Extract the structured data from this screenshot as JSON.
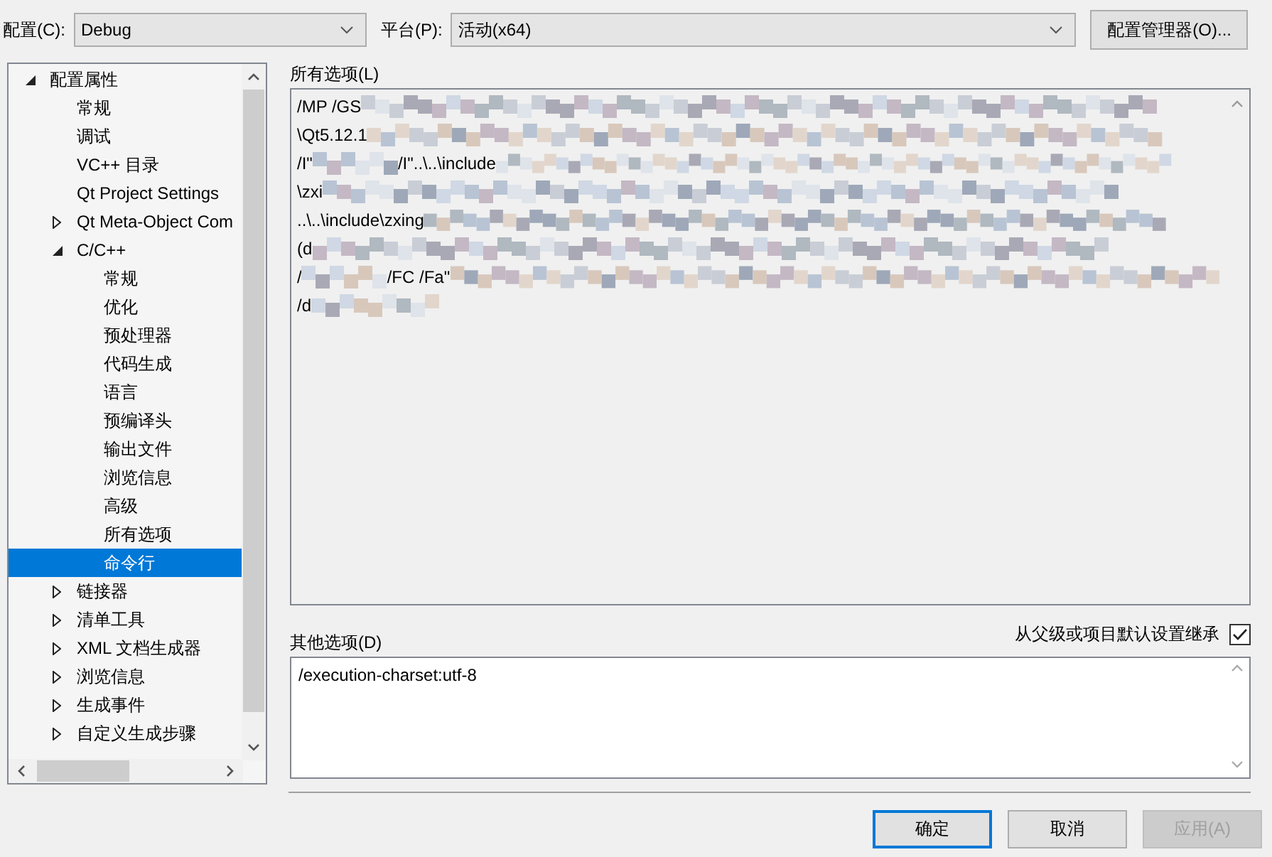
{
  "top_bar": {
    "config_label": "配置(C):",
    "config_value": "Debug",
    "platform_label": "平台(P):",
    "platform_value": "活动(x64)",
    "manager_button": "配置管理器(O)..."
  },
  "tree": [
    {
      "label": "配置属性",
      "expanded": true,
      "selected": false,
      "children": [
        {
          "label": "常规",
          "selected": false
        },
        {
          "label": "调试",
          "selected": false
        },
        {
          "label": "VC++ 目录",
          "selected": false
        },
        {
          "label": "Qt Project Settings",
          "selected": false
        },
        {
          "label": "Qt Meta-Object Com",
          "expanded": false,
          "selected": false
        },
        {
          "label": "C/C++",
          "expanded": true,
          "selected": false,
          "children": [
            {
              "label": "常规",
              "selected": false
            },
            {
              "label": "优化",
              "selected": false
            },
            {
              "label": "预处理器",
              "selected": false
            },
            {
              "label": "代码生成",
              "selected": false
            },
            {
              "label": "语言",
              "selected": false
            },
            {
              "label": "预编译头",
              "selected": false
            },
            {
              "label": "输出文件",
              "selected": false
            },
            {
              "label": "浏览信息",
              "selected": false
            },
            {
              "label": "高级",
              "selected": false
            },
            {
              "label": "所有选项",
              "selected": false
            },
            {
              "label": "命令行",
              "selected": true
            }
          ]
        },
        {
          "label": "链接器",
          "expanded": false,
          "selected": false
        },
        {
          "label": "清单工具",
          "expanded": false,
          "selected": false
        },
        {
          "label": "XML 文档生成器",
          "expanded": false,
          "selected": false
        },
        {
          "label": "浏览信息",
          "expanded": false,
          "selected": false
        },
        {
          "label": "生成事件",
          "expanded": false,
          "selected": false
        },
        {
          "label": "自定义生成步骤",
          "expanded": false,
          "selected": false
        }
      ]
    }
  ],
  "all_options": {
    "label": "所有选项(L)",
    "lines": [
      [
        "/MP /GS"
      ],
      [
        "\\Qt5.12.1"
      ],
      [
        "/I\"",
        "/I\"..\\..\\include"
      ],
      [
        "\\zxi"
      ],
      [
        "..\\..\\include\\zxing"
      ],
      [
        "(d"
      ],
      [
        "/",
        "/FC /Fa\""
      ],
      [
        "/d"
      ]
    ]
  },
  "other_options": {
    "label": "其他选项(D)",
    "inherit_label": "从父级或项目默认设置继承",
    "inherit_checked": true,
    "value": "/execution-charset:utf-8"
  },
  "buttons": [
    {
      "label": "确定",
      "default": true,
      "disabled": false
    },
    {
      "label": "取消",
      "default": false,
      "disabled": false
    },
    {
      "label": "应用(A)",
      "default": false,
      "disabled": true
    }
  ]
}
